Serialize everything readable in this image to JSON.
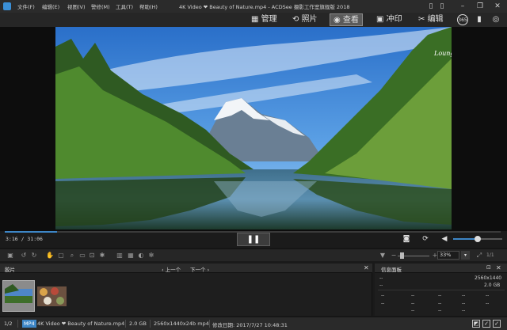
{
  "titlebar": {
    "menu": [
      "文件(F)",
      "编辑(E)",
      "视图(V)",
      "警修(M)",
      "工具(T)",
      "帮助(H)"
    ],
    "title": "4K Video ❤ Beauty of Nature.mp4 - ACDSee 摄影工作室旗舰版 2018"
  },
  "modes": {
    "manage": "管理",
    "photos": "照片",
    "view": "查看",
    "develop": "冲印",
    "edit": "编辑"
  },
  "viewer": {
    "watermark": "LoungeV.com"
  },
  "playback": {
    "time": "3:16 / 31:06",
    "progress": 0.105,
    "volume": 0.5
  },
  "toolbar": {
    "zoom": "33%",
    "page": "1/1"
  },
  "filmstrip": {
    "tab": "胶片",
    "prev": "上一个",
    "next": "下一个"
  },
  "info": {
    "tab": "信息面板",
    "rows": [
      [
        "--",
        "2560x1440"
      ],
      [
        "--",
        "2.0 GB"
      ]
    ],
    "grid": [
      "--",
      "--",
      "--",
      "--",
      "--",
      "--",
      "--",
      "--",
      "--",
      "--",
      "--",
      "--",
      "--"
    ]
  },
  "status": {
    "position": "1/2",
    "format": "MP4",
    "filename": "4K Video ❤ Beauty of Nature.mp4",
    "size": "2.0 GB",
    "dimensions": "2560x1440x24b mp4",
    "modified": "修改日期: 2017/7/27 10:48:31"
  },
  "colors": {
    "accent": "#3d86c6",
    "background": "#1a1a1a"
  }
}
